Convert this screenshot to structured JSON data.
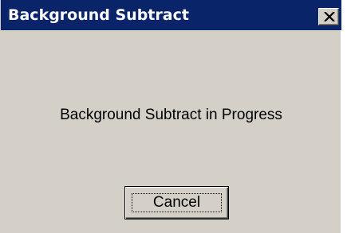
{
  "dialog": {
    "title": "Background Subtract",
    "close_icon": "close-icon",
    "message": "Background Subtract in Progress",
    "cancel_label": "Cancel"
  },
  "colors": {
    "titlebar": "#0a246a",
    "title_text": "#ffffff",
    "window_bg": "#d4d0c8",
    "text": "#000000"
  }
}
